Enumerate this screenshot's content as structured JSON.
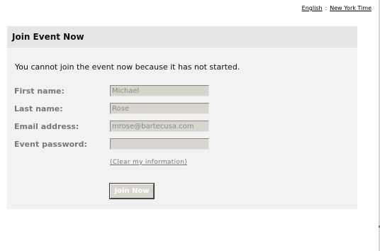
{
  "top_links": {
    "language": "English",
    "separator": ":",
    "timezone": "New York Time"
  },
  "panel": {
    "title": "Join Event Now",
    "message": "You cannot join the event now because it has not started."
  },
  "form": {
    "first_name": {
      "label": "First name:",
      "value": "Michael"
    },
    "last_name": {
      "label": "Last name:",
      "value": "Rose"
    },
    "email": {
      "label": "Email address:",
      "value": "mrose@bartecusa.com"
    },
    "password": {
      "label": "Event password:",
      "value": ""
    },
    "clear_link": "(Clear my information)",
    "join_button": "Join Now"
  }
}
